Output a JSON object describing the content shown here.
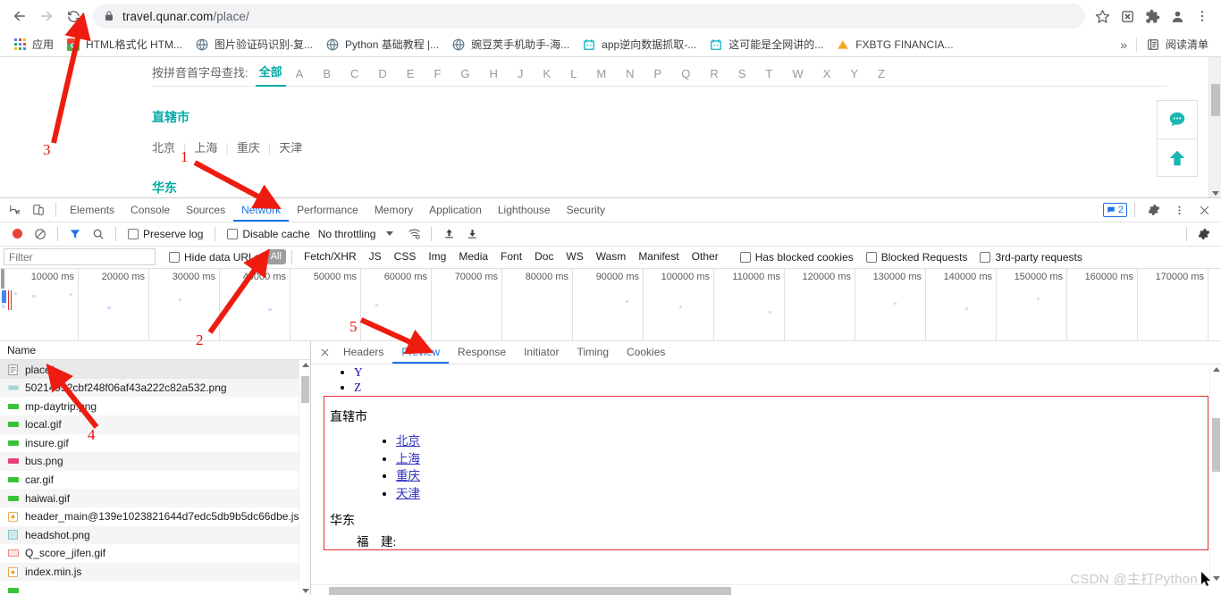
{
  "browser": {
    "url_prefix": "travel.qunar.com",
    "url_suffix": "/place/",
    "back_icon": "back-arrow-icon",
    "forward_icon": "forward-arrow-icon",
    "reload_icon": "reload-icon",
    "lock_icon": "lock-icon",
    "star_icon": "star-icon",
    "extension_icon": "extension-icon",
    "puzzle_icon": "puzzle-icon",
    "profile_icon": "profile-avatar-icon",
    "menu_icon": "three-dot-menu-icon"
  },
  "bookmarks": {
    "apps_label": "应用",
    "items": [
      {
        "label": "HTML格式化 HTM...",
        "icon": "page-favicon"
      },
      {
        "label": "图片验证码识别-复...",
        "icon": "globe-favicon"
      },
      {
        "label": "Python 基础教程 |...",
        "icon": "globe-favicon"
      },
      {
        "label": "豌豆荚手机助手-海...",
        "icon": "globe-favicon"
      },
      {
        "label": "app逆向数据抓取-...",
        "icon": "calendar-favicon"
      },
      {
        "label": "这可能是全网讲的...",
        "icon": "calendar-favicon"
      },
      {
        "label": "FXBTG FINANCIA...",
        "icon": "triangle-favicon"
      }
    ],
    "overflow_label": "»",
    "reading_list_label": "阅读清单",
    "reading_list_icon": "reading-list-icon"
  },
  "page": {
    "pinyin_label": "按拼音首字母查找:",
    "all_label": "全部",
    "letters": [
      "A",
      "B",
      "C",
      "D",
      "E",
      "F",
      "G",
      "H",
      "J",
      "K",
      "L",
      "M",
      "N",
      "P",
      "Q",
      "R",
      "S",
      "T",
      "W",
      "X",
      "Y",
      "Z"
    ],
    "region1_title": "直辖市",
    "region1_cities": [
      "北京",
      "上海",
      "重庆",
      "天津"
    ],
    "region2_title": "华东",
    "accent_color": "#00aaa6",
    "float_chat_icon": "chat-bubble-icon",
    "float_top_icon": "scroll-to-top-icon"
  },
  "devtools": {
    "inspect_icon": "inspect-element-icon",
    "device_icon": "device-toolbar-icon",
    "tabs": [
      "Elements",
      "Console",
      "Sources",
      "Network",
      "Performance",
      "Memory",
      "Application",
      "Lighthouse",
      "Security"
    ],
    "active_tab": "Network",
    "message_count": "2",
    "message_icon": "message-badge-icon",
    "settings_icon": "gear-icon",
    "more_icon": "three-dot-menu-icon",
    "close_icon": "close-icon",
    "toolbar": {
      "record_icon": "record-button-icon",
      "clear_icon": "clear-icon",
      "filter_icon": "funnel-filter-icon",
      "search_icon": "search-icon",
      "preserve_log": "Preserve log",
      "disable_cache": "Disable cache",
      "throttling": "No throttling",
      "wifi_icon": "network-conditions-icon",
      "import_icon": "import-har-icon",
      "export_icon": "export-har-icon",
      "settings_icon": "gear-icon"
    },
    "filterbar": {
      "filter_placeholder": "Filter",
      "filter_value": "",
      "hide_data_urls": "Hide data URLs",
      "types": [
        "All",
        "Fetch/XHR",
        "JS",
        "CSS",
        "Img",
        "Media",
        "Font",
        "Doc",
        "WS",
        "Wasm",
        "Manifest",
        "Other"
      ],
      "active_type": "All",
      "has_blocked_cookies": "Has blocked cookies",
      "blocked_requests": "Blocked Requests",
      "third_party_requests": "3rd-party requests"
    },
    "timeline": {
      "ticks": [
        "10000 ms",
        "20000 ms",
        "30000 ms",
        "40000 ms",
        "50000 ms",
        "60000 ms",
        "70000 ms",
        "80000 ms",
        "90000 ms",
        "100000 ms",
        "110000 ms",
        "120000 ms",
        "130000 ms",
        "140000 ms",
        "150000 ms",
        "160000 ms",
        "170000 ms"
      ]
    },
    "names_column_header": "Name",
    "requests": [
      {
        "name": "place/",
        "icon": "doc-icon",
        "selected": true
      },
      {
        "name": "50214952cbf248f06af43a222c82a532.png",
        "icon": "img-icon",
        "selected": false
      },
      {
        "name": "mp-daytrip.png",
        "icon": "img-icon",
        "selected": false
      },
      {
        "name": "local.gif",
        "icon": "img-icon",
        "selected": false
      },
      {
        "name": "insure.gif",
        "icon": "img-icon",
        "selected": false
      },
      {
        "name": "bus.png",
        "icon": "img-icon",
        "selected": false
      },
      {
        "name": "car.gif",
        "icon": "img-icon",
        "selected": false
      },
      {
        "name": "haiwai.gif",
        "icon": "img-icon",
        "selected": false
      },
      {
        "name": "header_main@139e1023821644d7edc5db9b5dc66dbe.js",
        "icon": "js-icon",
        "selected": false
      },
      {
        "name": "headshot.png",
        "icon": "img-icon",
        "selected": false
      },
      {
        "name": "Q_score_jifen.gif",
        "icon": "img-icon",
        "selected": false
      },
      {
        "name": "index.min.js",
        "icon": "js-icon",
        "selected": false
      }
    ],
    "detail_tabs": [
      "Headers",
      "Preview",
      "Response",
      "Initiator",
      "Timing",
      "Cookies"
    ],
    "detail_active_tab": "Preview",
    "preview": {
      "top_list": [
        "Y",
        "Z"
      ],
      "heading": "直辖市",
      "cities": [
        "北京",
        "上海",
        "重庆",
        "天津"
      ],
      "heading2": "华东",
      "subitem": "福　建:"
    }
  },
  "annotations": {
    "numbers": [
      "1",
      "2",
      "3",
      "4",
      "5"
    ]
  },
  "watermark": "CSDN @主打Python"
}
